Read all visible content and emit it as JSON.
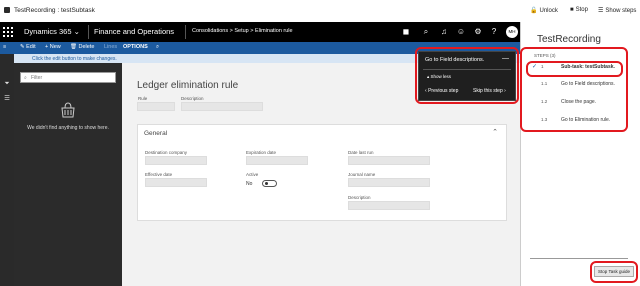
{
  "window": {
    "title": "TestRecording : testSubtask",
    "actions": [
      {
        "icon": "unlock-icon",
        "label": "Unlock"
      },
      {
        "icon": "stop-icon",
        "label": "Stop"
      },
      {
        "icon": "show-steps-icon",
        "label": "Show steps"
      }
    ]
  },
  "nav": {
    "brand": "Dynamics 365",
    "brand_chevron": "⌄",
    "module": "Finance and Operations",
    "breadcrumb": "Consolidations  >  Setup  >  Elimination rule",
    "avatar": "MH",
    "icons": [
      "chat-icon",
      "search-icon",
      "bell-icon",
      "smiley-icon",
      "gear-icon",
      "help-icon"
    ]
  },
  "toolbar": {
    "edit": "Edit",
    "new": "New",
    "delete": "Delete",
    "lines": "Lines",
    "options": "OPTIONS"
  },
  "infobar": {
    "text": "Click the edit button to make changes."
  },
  "list": {
    "filter_placeholder": "Filter",
    "empty_text": "We didn't find anything to show here."
  },
  "form": {
    "title": "Ledger elimination rule",
    "rule_label": "Rule",
    "description_label": "Description",
    "section_title": "General",
    "destination_company_label": "Destination company",
    "effective_date_label": "Effective date",
    "expiration_date_label": "Expiration date",
    "active_label": "Active",
    "active_value": "No",
    "date_last_run_label": "Date last run",
    "journal_name_label": "Journal name",
    "description2_label": "Description"
  },
  "popup": {
    "heading": "Go to Field descriptions.",
    "show_less": "Show less",
    "previous": "Previous step",
    "skip": "Skip this step"
  },
  "task_recorder": {
    "title": "TestRecording",
    "steps_header": "STEPS (3)",
    "steps": [
      {
        "num": "1",
        "label": "Sub-task: testSubtask."
      },
      {
        "num": "1.1",
        "label": "Go to Field descriptions."
      },
      {
        "num": "1.2",
        "label": "Close the page."
      },
      {
        "num": "1.3",
        "label": "Go to Elimination rule."
      }
    ],
    "stop_button": "Stop Task guide"
  },
  "colors": {
    "nav_bg": "#000000",
    "toolbar_bg": "#1c5a9f",
    "highlight": "#e2191f"
  }
}
